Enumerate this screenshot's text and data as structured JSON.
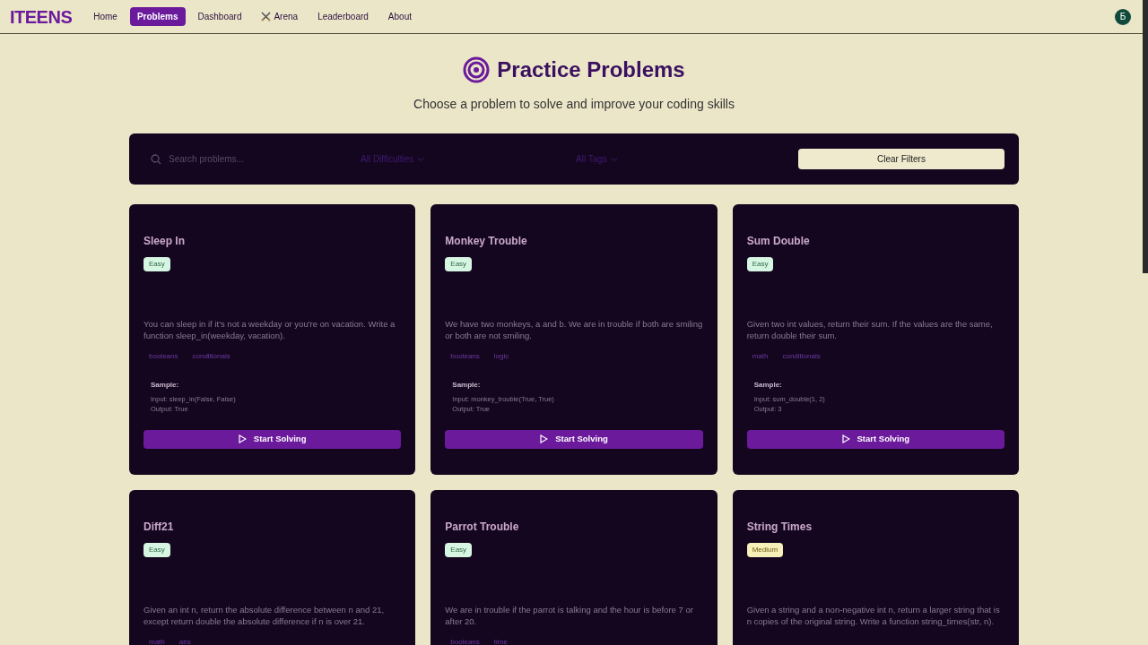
{
  "nav": {
    "logo": "ITEENS",
    "links": [
      {
        "label": "Home",
        "selected": false,
        "icon": false
      },
      {
        "label": "Problems",
        "selected": true,
        "icon": false
      },
      {
        "label": "Dashboard",
        "selected": false,
        "icon": false
      },
      {
        "label": "Arena",
        "selected": false,
        "icon": true
      },
      {
        "label": "Leaderboard",
        "selected": false,
        "icon": false
      },
      {
        "label": "About",
        "selected": false,
        "icon": false
      }
    ],
    "avatar": "Б"
  },
  "header": {
    "title": "Practice Problems",
    "subtitle": "Choose a problem to solve and improve your coding skills"
  },
  "filters": {
    "search_placeholder": "Search problems...",
    "difficulty": "All Difficulties",
    "tags": "All Tags",
    "clear": "Clear Filters"
  },
  "problems": [
    {
      "title": "Sleep In",
      "difficulty": "Easy",
      "kind": "easy",
      "description": "You can sleep in if it's not a weekday or you're on vacation. Write a function sleep_in(weekday, vacation).",
      "tags": [
        "booleans",
        "conditionals"
      ],
      "sample": {
        "label": "Sample:",
        "input": "Input: sleep_in(False, False)",
        "output": "Output: True"
      },
      "button": "Start Solving"
    },
    {
      "title": "Monkey Trouble",
      "difficulty": "Easy",
      "kind": "easy",
      "description": "We have two monkeys, a and b. We are in trouble if both are smiling or both are not smiling.",
      "tags": [
        "booleans",
        "logic"
      ],
      "sample": {
        "label": "Sample:",
        "input": "Input: monkey_trouble(True, True)",
        "output": "Output: True"
      },
      "button": "Start Solving"
    },
    {
      "title": "Sum Double",
      "difficulty": "Easy",
      "kind": "easy",
      "description": "Given two int values, return their sum. If the values are the same, return double their sum.",
      "tags": [
        "math",
        "conditionals"
      ],
      "sample": {
        "label": "Sample:",
        "input": "Input: sum_double(1, 2)",
        "output": "Output: 3"
      },
      "button": "Start Solving"
    },
    {
      "title": "Diff21",
      "difficulty": "Easy",
      "kind": "easy",
      "description": "Given an int n, return the absolute difference between n and 21, except return double the absolute difference if n is over 21.",
      "tags": [
        "math",
        "abs"
      ]
    },
    {
      "title": "Parrot Trouble",
      "difficulty": "Easy",
      "kind": "easy",
      "description": "We are in trouble if the parrot is talking and the hour is before 7 or after 20.",
      "tags": [
        "booleans",
        "time"
      ]
    },
    {
      "title": "String Times",
      "difficulty": "Medium",
      "kind": "medium",
      "description": "Given a string and a non-negative int n, return a larger string that is n copies of the original string. Write a function string_times(str, n)."
    }
  ]
}
